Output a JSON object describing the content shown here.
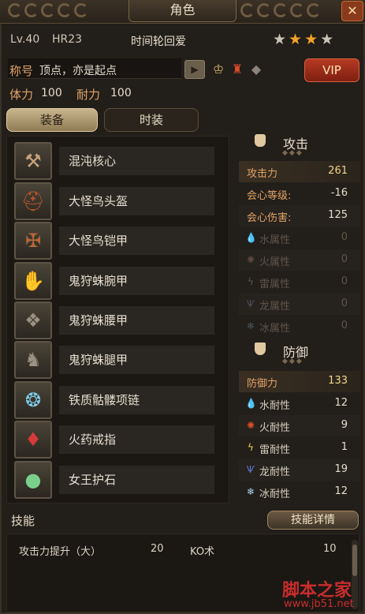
{
  "header": {
    "title": "角色",
    "close_icon": "close-icon"
  },
  "player": {
    "level": "Lv.40",
    "hr": "HR23",
    "name": "时间轮回爱",
    "stars": 4,
    "title_label": "称号",
    "title_value": "顶点，亦是起点",
    "vip_label": "VIP",
    "stamina_label": "体力",
    "stamina_value": "100",
    "endurance_label": "耐力",
    "endurance_value": "100"
  },
  "tabs": {
    "equipment": "装备",
    "fashion": "时装"
  },
  "equipment": [
    {
      "name": "混沌核心",
      "icon": "axe-icon"
    },
    {
      "name": "大怪鸟头盔",
      "icon": "helmet-icon"
    },
    {
      "name": "大怪鸟铠甲",
      "icon": "armor-icon"
    },
    {
      "name": "鬼狩蛛腕甲",
      "icon": "gauntlet-icon"
    },
    {
      "name": "鬼狩蛛腰甲",
      "icon": "waist-icon"
    },
    {
      "name": "鬼狩蛛腿甲",
      "icon": "boots-icon"
    },
    {
      "name": "铁质骷髅项链",
      "icon": "necklace-icon"
    },
    {
      "name": "火药戒指",
      "icon": "ring-icon"
    },
    {
      "name": "女王护石",
      "icon": "charm-icon"
    }
  ],
  "attack": {
    "title": "攻击",
    "rows": [
      {
        "label": "攻击力",
        "value": "261"
      },
      {
        "label": "会心等级:",
        "value": "-16"
      },
      {
        "label": "会心伤害:",
        "value": "125"
      },
      {
        "label": "水属性",
        "value": "0",
        "icon": "water-icon"
      },
      {
        "label": "火属性",
        "value": "0",
        "icon": "fire-icon"
      },
      {
        "label": "雷属性",
        "value": "0",
        "icon": "thunder-icon"
      },
      {
        "label": "龙属性",
        "value": "0",
        "icon": "dragon-icon"
      },
      {
        "label": "冰属性",
        "value": "0",
        "icon": "ice-icon"
      }
    ]
  },
  "defense": {
    "title": "防御",
    "rows": [
      {
        "label": "防御力",
        "value": "133"
      },
      {
        "label": "水耐性",
        "value": "12",
        "icon": "water-icon"
      },
      {
        "label": "火耐性",
        "value": "9",
        "icon": "fire-icon"
      },
      {
        "label": "雷耐性",
        "value": "1",
        "icon": "thunder-icon"
      },
      {
        "label": "龙耐性",
        "value": "19",
        "icon": "dragon-icon"
      },
      {
        "label": "冰耐性",
        "value": "12",
        "icon": "ice-icon"
      }
    ]
  },
  "skills": {
    "label": "技能",
    "detail_button": "技能详情",
    "items": [
      {
        "name": "攻击力提升（大）",
        "value": "20"
      },
      {
        "name": "KO术",
        "value": "10"
      }
    ]
  },
  "watermark": {
    "line1": "脚本之家",
    "line2": "www.jb51.net"
  },
  "colors": {
    "accent": "#e3a468",
    "gold": "#f2d68a",
    "vip": "#b53a23",
    "water": "#6fb7e8",
    "fire": "#e0502a",
    "thunder": "#e8d44a",
    "dragon": "#5a7ad8",
    "ice": "#a9d6ef"
  }
}
